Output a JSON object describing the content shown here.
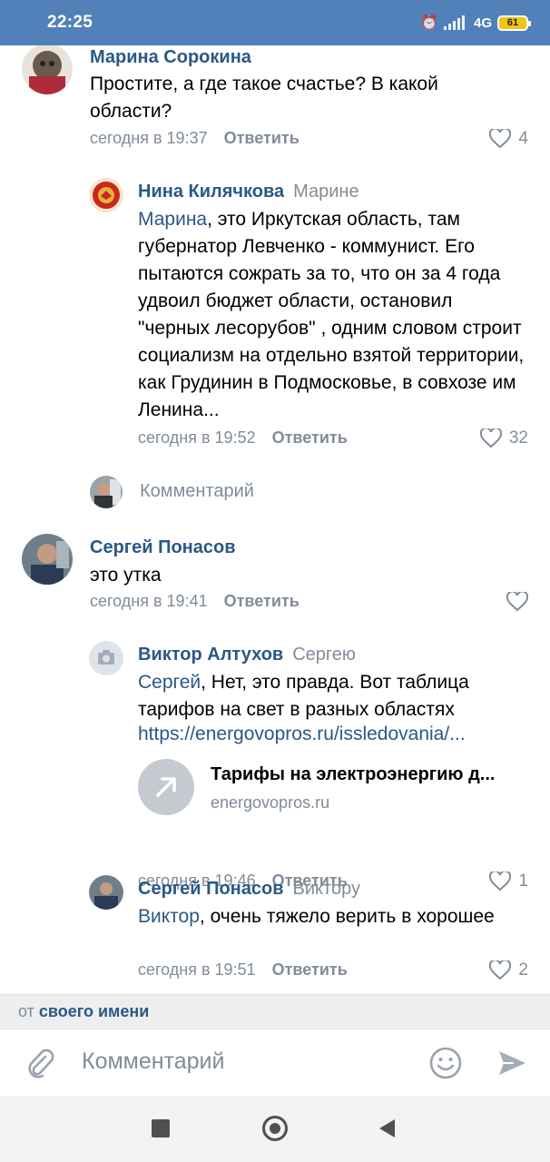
{
  "status": {
    "time": "22:25",
    "network": "4G",
    "battery": "61"
  },
  "comments": [
    {
      "name": "Марина Сорокина",
      "to": "",
      "mention": "",
      "text": "Простите, а где такое счастье? В какой области?",
      "time": "сегодня в 19:37",
      "reply": "Ответить",
      "likes": "4"
    },
    {
      "name": "Нина Килячкова",
      "to": "Марине",
      "mention": "Марина",
      "text": ", это Иркутская область, там губернатор Левченко - коммунист. Его пытаются сожрать за то, что он за 4 года удвоил бюджет области, остановил \"черных лесорубов\" , одним словом строит социализм на отдельно взятой территории, как Грудинин в Подмосковье, в совхозе им Ленина...",
      "time": "сегодня в 19:52",
      "reply": "Ответить",
      "likes": "32"
    },
    {
      "name": "Сергей Понасов",
      "to": "",
      "mention": "",
      "text": "это утка",
      "time": "сегодня в 19:41",
      "reply": "Ответить",
      "likes": ""
    },
    {
      "name": "Виктор Алтухов",
      "to": "Сергею",
      "mention": "Сергей",
      "text": ", Нет, это правда. Вот таблица тарифов на свет в разных областях",
      "link": "https://energovopros.ru/issledovania/...",
      "time": "сегодня в 19:46",
      "reply": "Ответить",
      "likes": "1"
    },
    {
      "name": "Сергей Понасов",
      "to": "Виктору",
      "mention": "Виктор",
      "text": ", очень тяжело верить в хорошее",
      "time": "сегодня в 19:51",
      "reply": "Ответить",
      "likes": "2"
    }
  ],
  "attachment": {
    "title": "Тарифы на электроэнергию д...",
    "domain": "energovopros.ru"
  },
  "thread_reply_placeholder": "Комментарий",
  "from": {
    "prefix": "от",
    "value": "своего имени"
  },
  "input": {
    "placeholder": "Комментарий"
  },
  "colors": {
    "accent": "#5181b8",
    "link": "#2a5885",
    "muted": "#818c99"
  }
}
